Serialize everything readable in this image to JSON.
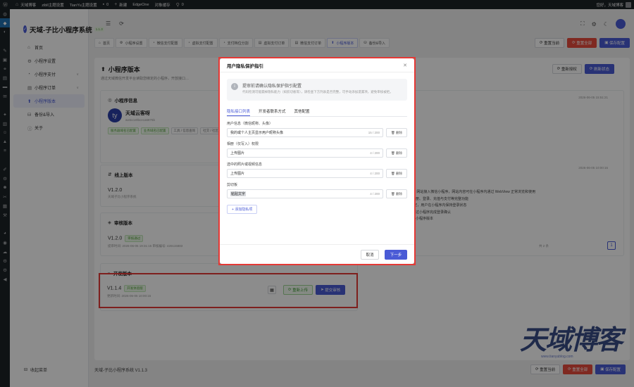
{
  "colors": {
    "accent": "#4a5bd6",
    "danger": "#e74c3c",
    "success": "#52a33a",
    "highlight_box": "#e53935"
  },
  "adminbar": {
    "site_name": "天域博客",
    "items": [
      "zibll主题设置",
      "TianYu主题设置",
      "0",
      "新建",
      "EdgeOne",
      "对象缓存",
      "0"
    ],
    "greeting": "您好，天域博客"
  },
  "sidebar": {
    "brand_name": "天域-子比小程序系统",
    "brand_version": "1.1.3",
    "items": [
      {
        "label": "首页",
        "icon": "home-icon"
      },
      {
        "label": "小程序设置",
        "icon": "settings-icon"
      },
      {
        "label": "小程序支付",
        "icon": "pay-icon"
      },
      {
        "label": "小程序订单",
        "icon": "order-icon"
      },
      {
        "label": "小程序版本",
        "icon": "version-icon"
      },
      {
        "label": "备份&导入",
        "icon": "backup-icon"
      },
      {
        "label": "关于",
        "icon": "info-icon"
      }
    ],
    "collapse": "收起菜单"
  },
  "tabs": [
    "首页",
    "小程序设置",
    "微信支付配置",
    "虚拟支付配置",
    "支付档位分割",
    "虚拟支付订单",
    "微信支付订单",
    "小程序版本",
    "备份&导入"
  ],
  "toolbar": {
    "reset_current": "重置当前",
    "reset_all": "重置全部",
    "save": "保存配置"
  },
  "page": {
    "title": "小程序版本",
    "desc": "通过天域微信开发平台读取您绑定的小程序，开放接口…",
    "sync_auth": "重新授权",
    "refresh": "刷新状态"
  },
  "app_card": {
    "title": "小程序信息",
    "name": "天域云客呀",
    "appid": "wx6cce0bceca6876b",
    "chips": [
      "服务器域名已配置",
      "业务域名已配置",
      "工具 / 信息查询",
      "社交 / 社区 / 论坛",
      "商业服务 / 软件 / 建站 / 技术服务"
    ]
  },
  "online": {
    "title": "线上版本",
    "version": "V1.2.0",
    "desc": "天域子比小程序系统"
  },
  "audit": {
    "title": "审核版本",
    "version": "V1.2.0",
    "status": "审核通过",
    "time": "提审时间: 2026-06-05 19:31:15  审核编号: 426115883"
  },
  "dev": {
    "title": "开发版本",
    "version": "V1.1.4",
    "status": "开发体验版",
    "time": "更新时间: 2026-06-05 10:00:15",
    "reupload": "重新上传",
    "submit": "提交审核"
  },
  "right_panel": {
    "time1": "2026-06-05 15:51:21",
    "time2": "2026-06-05 10:00:15",
    "lines": [
      "天域子比小程序系统将 zibll 网站接入微信小程序，网站内容可在小程序内通过 WebView 正常浏览和使用",
      "包括文章、圈子、评论、注册、登录、充值与支付等完整功能",
      "与 WordPress 用户自动绑定，用户在小程序内保持登录状态",
      "用户在网站端打开后，可通过小程序完成登录确认",
      "可以在网站后台配置不同的小程序版本"
    ],
    "total": "共 2 条",
    "page": "1"
  },
  "footer": {
    "text": "天域-子比小程序系统 V1.1.3"
  },
  "watermark": {
    "brand": "天域博客",
    "url": "www.tianyublog.com"
  },
  "modal": {
    "title": "用户隐私保护指引",
    "notice_title": "提审前请确认隐私保护指引配置",
    "notice_desc": "代码检测可能漏掉隐私能力（如剪切板等），请检查下方列表是否完整，可手动添加遗漏项，避免审核被拒。",
    "tabs": [
      "隐私接口列表",
      "开发者联系方式",
      "其他配置"
    ],
    "fields": [
      {
        "label": "用户信息（微信昵称、头像）",
        "value": "我的或个人主页显示用户昵称头像",
        "count": "15 / 200"
      },
      {
        "label": "相册（仅写入）权限",
        "value": "上传图片",
        "count": "4 / 200"
      },
      {
        "label": "选中的照片或视频信息",
        "value": "上传图片",
        "count": "4 / 200"
      },
      {
        "label": "剪切板",
        "value": "粘贴文字",
        "count": "4 / 200"
      }
    ],
    "delete": "删除",
    "add": "添加隐私项",
    "cancel": "取消",
    "next": "下一步"
  }
}
